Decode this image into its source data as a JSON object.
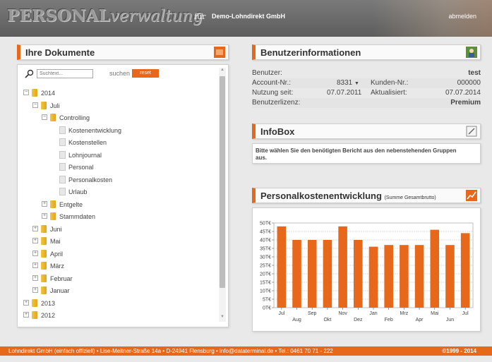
{
  "header": {
    "logo_part1": "PERSONAL",
    "logo_part2": "verwaltung",
    "fuer": "für",
    "company": "Demo-Lohndirekt GmbH",
    "logout": "abmelden"
  },
  "documents": {
    "title": "Ihre Dokumente",
    "search_placeholder": "Suchtext...",
    "search_label": "suchen",
    "reset_label": "reset",
    "tree": [
      {
        "label": "2014",
        "level": 0,
        "kind": "folder",
        "exp": "−"
      },
      {
        "label": "Juli",
        "level": 1,
        "kind": "folder",
        "exp": "−"
      },
      {
        "label": "Controlling",
        "level": 2,
        "kind": "folder",
        "exp": "−"
      },
      {
        "label": "Kostenentwicklung",
        "level": 3,
        "kind": "doc"
      },
      {
        "label": "Kostenstellen",
        "level": 3,
        "kind": "doc"
      },
      {
        "label": "Lohnjournal",
        "level": 3,
        "kind": "doc"
      },
      {
        "label": "Personal",
        "level": 3,
        "kind": "doc"
      },
      {
        "label": "Personalkosten",
        "level": 3,
        "kind": "doc"
      },
      {
        "label": "Urlaub",
        "level": 3,
        "kind": "doc"
      },
      {
        "label": "Entgelte",
        "level": 2,
        "kind": "folder",
        "exp": "+"
      },
      {
        "label": "Stammdaten",
        "level": 2,
        "kind": "folder",
        "exp": "+"
      },
      {
        "label": "Juni",
        "level": 1,
        "kind": "folder",
        "exp": "+"
      },
      {
        "label": "Mai",
        "level": 1,
        "kind": "folder",
        "exp": "+"
      },
      {
        "label": "April",
        "level": 1,
        "kind": "folder",
        "exp": "+"
      },
      {
        "label": "März",
        "level": 1,
        "kind": "folder",
        "exp": "+"
      },
      {
        "label": "Februar",
        "level": 1,
        "kind": "folder",
        "exp": "+"
      },
      {
        "label": "Januar",
        "level": 1,
        "kind": "folder",
        "exp": "+"
      },
      {
        "label": "2013",
        "level": 0,
        "kind": "folder",
        "exp": "+"
      },
      {
        "label": "2012",
        "level": 0,
        "kind": "folder",
        "exp": "+"
      }
    ]
  },
  "user_info": {
    "title": "Benutzerinformationen",
    "benutzer_label": "Benutzer:",
    "benutzer_value": "test",
    "account_label": "Account-Nr.:",
    "account_value": "8331",
    "kunden_label": "Kunden-Nr.:",
    "kunden_value": "000000",
    "nutzung_label": "Nutzung seit:",
    "nutzung_value": "07.07.2011",
    "aktualisiert_label": "Aktualisiert:",
    "aktualisiert_value": "07.07.2014",
    "lizenz_label": "Benutzerlizenz:",
    "lizenz_value": "Premium"
  },
  "infobox": {
    "title": "InfoBox",
    "text": "Bitte wählen Sie den benötigten Bericht aus den nebenstehenden Gruppen aus."
  },
  "chart_panel": {
    "title": "Personalkostenentwicklung",
    "subtitle": "(Summe Gesamtbrutto)"
  },
  "chart_data": {
    "type": "bar",
    "title": "Personalkostenentwicklung",
    "subtitle": "(Summe Gesamtbrutto)",
    "categories": [
      "Jul",
      "Aug",
      "Sep",
      "Okt",
      "Nov",
      "Dez",
      "Jan",
      "Feb",
      "Mrz",
      "Apr",
      "Mai",
      "Jun",
      "Jul"
    ],
    "values": [
      48,
      40,
      40,
      40,
      48,
      40,
      36,
      37,
      37,
      37,
      46,
      37,
      44
    ],
    "yticks": [
      "0T€",
      "5T€",
      "10T€",
      "15T€",
      "20T€",
      "25T€",
      "30T€",
      "35T€",
      "40T€",
      "45T€",
      "50T€"
    ],
    "ylim": [
      0,
      50
    ],
    "grid": true,
    "bar_color": "#e8681b"
  },
  "footer": {
    "address": "Lohndirekt GmbH (einfach offiziell) • Lise-Meitner-Straße 14a • D-24941 Flensburg • info@dataterminal.de • Tel.: 0461 70 71 - 222",
    "copyright": "©1999 - 2014"
  }
}
